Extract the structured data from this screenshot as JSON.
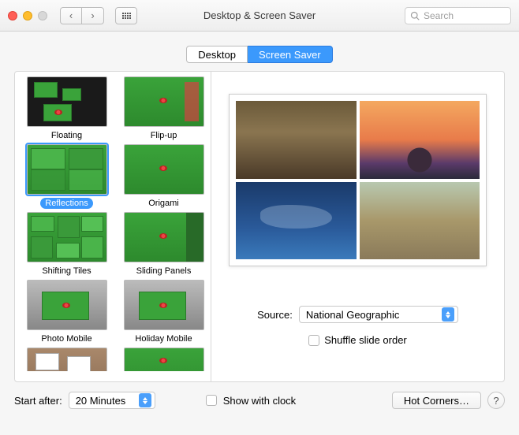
{
  "window": {
    "title": "Desktop & Screen Saver",
    "search_placeholder": "Search"
  },
  "tabs": {
    "desktop": "Desktop",
    "screensaver": "Screen Saver"
  },
  "savers": [
    {
      "label": "Floating"
    },
    {
      "label": "Flip-up"
    },
    {
      "label": "Reflections"
    },
    {
      "label": "Origami"
    },
    {
      "label": "Shifting Tiles"
    },
    {
      "label": "Sliding Panels"
    },
    {
      "label": "Photo Mobile"
    },
    {
      "label": "Holiday Mobile"
    }
  ],
  "source": {
    "label": "Source:",
    "value": "National Geographic"
  },
  "shuffle": {
    "label": "Shuffle slide order",
    "checked": false
  },
  "start_after": {
    "label": "Start after:",
    "value": "20 Minutes"
  },
  "show_clock": {
    "label": "Show with clock",
    "checked": false
  },
  "hot_corners": "Hot Corners…",
  "help": "?"
}
